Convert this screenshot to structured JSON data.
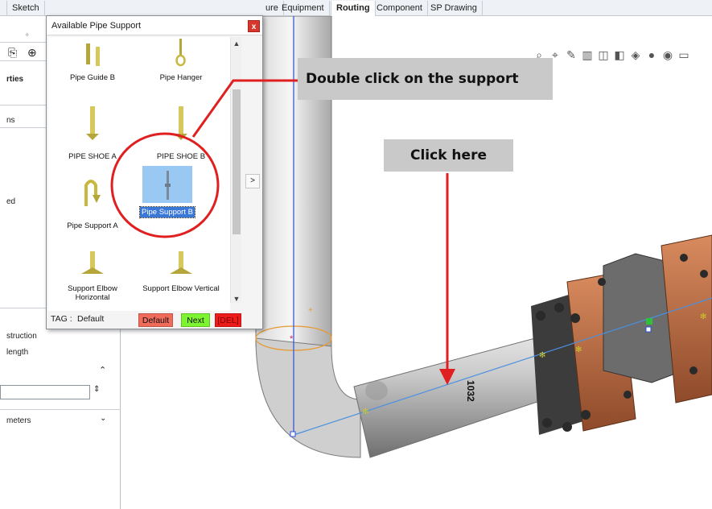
{
  "tabs": [
    {
      "label": "Sketch",
      "active": false
    },
    {
      "label": "ure",
      "active": false
    },
    {
      "label": "Equipment",
      "active": false
    },
    {
      "label": "Routing",
      "active": true
    },
    {
      "label": "Component",
      "active": false
    },
    {
      "label": "SP Drawing",
      "active": false
    }
  ],
  "left_panel": {
    "properties_label": "rties",
    "ns_label": "ns",
    "ed_label": "ed",
    "construction_label": "struction",
    "length_label": "length",
    "meters_label": "meters"
  },
  "dialog": {
    "title": "Available Pipe Support",
    "close_label": "x",
    "items": [
      {
        "label": "Pipe Guide B",
        "selected": false,
        "icon": "pipe-guide-b-icon"
      },
      {
        "label": "Pipe Hanger",
        "selected": false,
        "icon": "pipe-hanger-icon"
      },
      {
        "label": "PIPE SHOE A",
        "selected": false,
        "icon": "pipe-shoe-a-icon"
      },
      {
        "label": "PIPE SHOE B",
        "selected": false,
        "icon": "pipe-shoe-b-icon"
      },
      {
        "label": "Pipe Support A",
        "selected": false,
        "icon": "pipe-support-a-icon"
      },
      {
        "label": "Pipe Support B",
        "selected": true,
        "icon": "pipe-support-b-icon"
      },
      {
        "label": "Support Elbow Horizontal",
        "selected": false,
        "icon": "support-elbow-horizontal-icon"
      },
      {
        "label": "Support Elbow Vertical",
        "selected": false,
        "icon": "support-elbow-vertical-icon"
      }
    ],
    "side_button_label": ">",
    "tag_label": "TAG :",
    "tag_value": "Default",
    "buttons": {
      "default_label": "Default",
      "next_label": "Next",
      "del_label": "[DEL]"
    }
  },
  "callouts": {
    "double_click": "Double click on the support",
    "click_here": "Click here"
  },
  "viewport": {
    "dimension_label": "1032"
  },
  "colors": {
    "accent_red": "#e02020",
    "callout_bg": "#c9c9c9",
    "selection_blue": "#3a78d8",
    "pipe_blue_line": "#2b4fd8",
    "copper_flange": "#c8754a"
  }
}
